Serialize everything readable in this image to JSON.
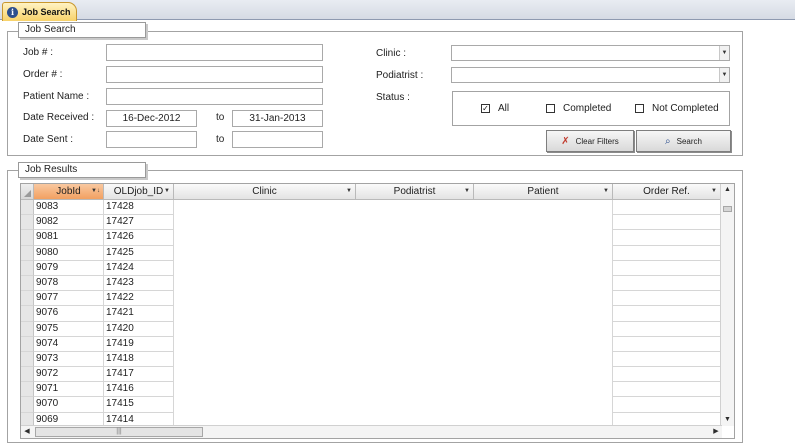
{
  "tab": {
    "icon": "app-info-icon",
    "label": "Job Search"
  },
  "search": {
    "group_title": "Job Search",
    "labels": {
      "job_no": "Job # :",
      "order_no": "Order # :",
      "patient_name": "Patient Name :",
      "date_received": "Date Received :",
      "date_sent": "Date Sent :",
      "to1": "to",
      "to2": "to",
      "clinic": "Clinic :",
      "podiatrist": "Podiatrist :",
      "status": "Status :"
    },
    "values": {
      "job_no": "",
      "order_no": "",
      "patient_name": "",
      "date_received_from": "16-Dec-2012",
      "date_received_to": "31-Jan-2013",
      "date_sent_from": "",
      "date_sent_to": "",
      "clinic": "",
      "podiatrist": ""
    },
    "status_options": [
      {
        "label": "All",
        "checked": true
      },
      {
        "label": "Completed",
        "checked": false
      },
      {
        "label": "Not Completed",
        "checked": false
      }
    ],
    "buttons": {
      "clear_filters": "Clear Filters",
      "search": "Search"
    }
  },
  "results": {
    "group_title": "Job Results",
    "columns": [
      "JobId",
      "OLDjob_ID",
      "Clinic",
      "Podiatrist",
      "Patient",
      "Order Ref."
    ],
    "rows": [
      [
        "9083",
        "17428"
      ],
      [
        "9082",
        "17427"
      ],
      [
        "9081",
        "17426"
      ],
      [
        "9080",
        "17425"
      ],
      [
        "9079",
        "17424"
      ],
      [
        "9078",
        "17423"
      ],
      [
        "9077",
        "17422"
      ],
      [
        "9076",
        "17421"
      ],
      [
        "9075",
        "17420"
      ],
      [
        "9074",
        "17419"
      ],
      [
        "9073",
        "17418"
      ],
      [
        "9072",
        "17417"
      ],
      [
        "9071",
        "17416"
      ],
      [
        "9070",
        "17415"
      ],
      [
        "9069",
        "17414"
      ]
    ]
  },
  "colors": {
    "selected_header": "#f2a061",
    "tab_gold": "#f8d26a",
    "border": "#a3a3a3"
  }
}
